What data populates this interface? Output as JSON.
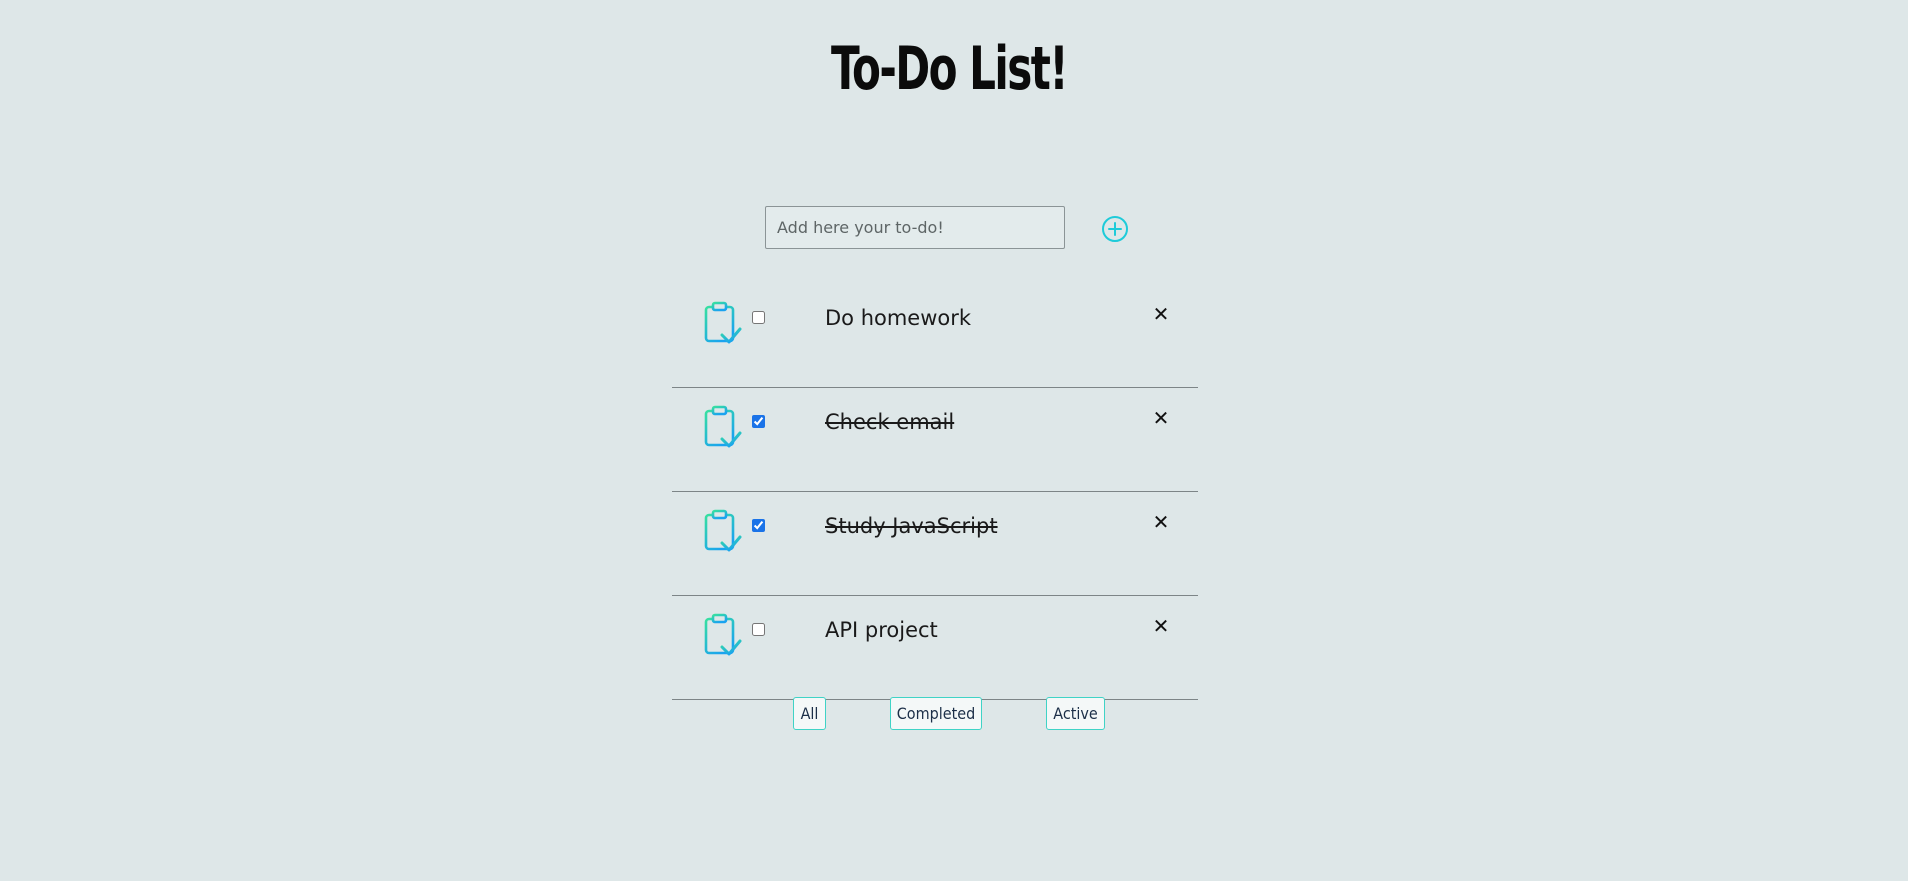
{
  "app": {
    "title": "To-Do List!"
  },
  "add_form": {
    "placeholder": "Add here your to-do!",
    "value": "",
    "add_icon": "plus-circle-icon"
  },
  "todos": [
    {
      "text": "Do homework",
      "completed": false,
      "icon": "clipboard-check-icon",
      "delete_label": "✕"
    },
    {
      "text": "Check email",
      "completed": true,
      "icon": "clipboard-check-icon",
      "delete_label": "✕"
    },
    {
      "text": "Study JavaScript",
      "completed": true,
      "icon": "clipboard-check-icon",
      "delete_label": "✕"
    },
    {
      "text": "API project",
      "completed": false,
      "icon": "clipboard-check-icon",
      "delete_label": "✕"
    }
  ],
  "filters": [
    {
      "label": "All"
    },
    {
      "label": "Completed"
    },
    {
      "label": "Active"
    }
  ],
  "colors": {
    "background": "#dee7e8",
    "accent": "#1ecbd9",
    "icon_gradient_start": "#37e0a0",
    "icon_gradient_end": "#1aa3f0",
    "filter_border": "#3fd3c6"
  }
}
